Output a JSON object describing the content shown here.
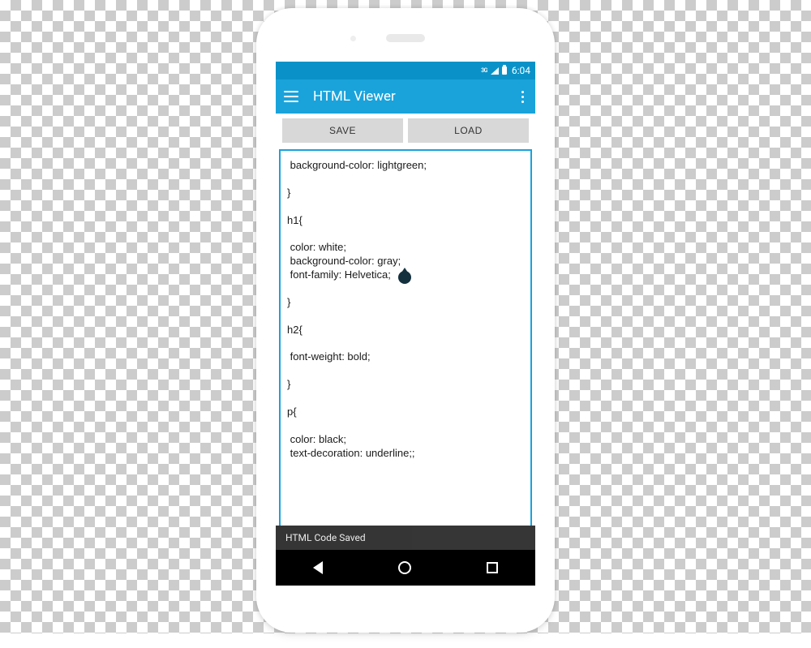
{
  "statusbar": {
    "network": "3G",
    "time": "6:04"
  },
  "appbar": {
    "title": "HTML Viewer"
  },
  "buttons": {
    "save": "SAVE",
    "load": "LOAD"
  },
  "editor": {
    "lines": [
      " background-color: lightgreen;",
      "",
      "}",
      "",
      "h1{",
      "",
      " color: white;",
      " background-color: gray;",
      " font-family: Helvetica;",
      "",
      "}",
      "",
      "h2{",
      "",
      " font-weight: bold;",
      "",
      "}",
      "",
      "p{",
      "",
      " color: black;",
      " text-decoration: underline;;"
    ]
  },
  "toast": {
    "message": "HTML Code Saved"
  }
}
